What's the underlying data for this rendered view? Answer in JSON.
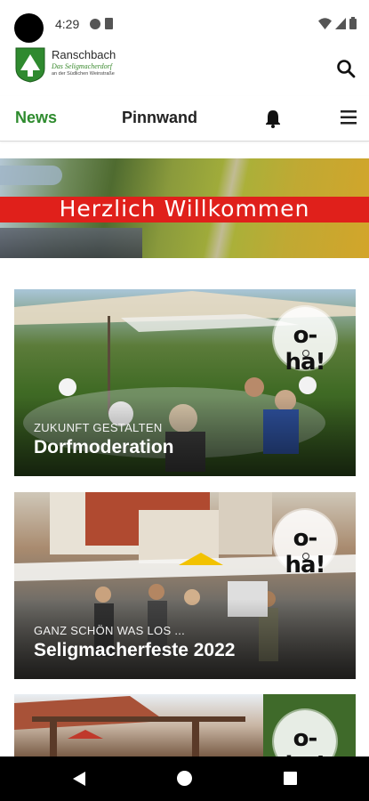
{
  "status_bar": {
    "time": "4:29",
    "icons": [
      "camera-icon",
      "globe-icon",
      "sim-icon",
      "wifi-icon",
      "signal-icon",
      "battery-icon"
    ]
  },
  "header": {
    "brand_name": "Ranschbach",
    "brand_tagline": "Das Seligmacherdorf",
    "brand_subline": "an der Südlichen Weinstraße",
    "search_icon": "search-icon"
  },
  "nav": {
    "news": "News",
    "pinnwand": "Pinnwand",
    "bell_icon": "bell-icon",
    "menu_icon": "menu-icon",
    "active_color": "#2e8b2e"
  },
  "banner": {
    "text": "Herzlich Willkommen",
    "strip_color": "#e0201b"
  },
  "cards": [
    {
      "kicker": "ZUKUNFT GESTALTEN",
      "title": "Dorfmoderation",
      "badge": "o-ha!"
    },
    {
      "kicker": "GANZ SCHÖN WAS LOS ...",
      "title": "Seligmacherfeste 2022",
      "badge": "o-ha!"
    },
    {
      "kicker": "",
      "title": "",
      "badge": "o-ha!"
    }
  ],
  "system_nav": {
    "back_icon": "back-icon",
    "home_icon": "home-icon",
    "recents_icon": "recents-icon"
  }
}
